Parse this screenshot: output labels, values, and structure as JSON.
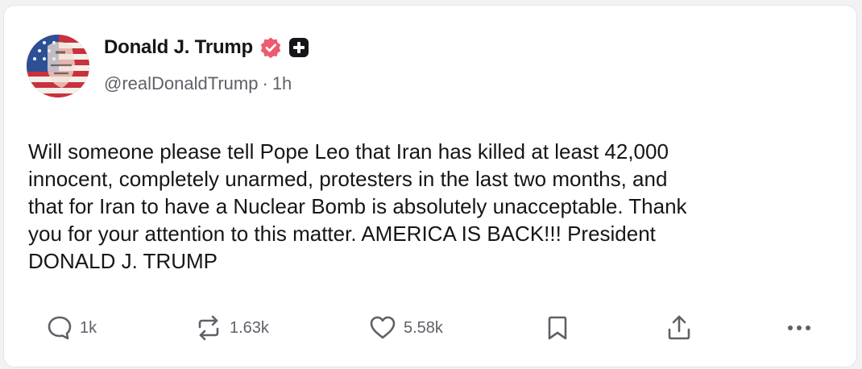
{
  "post": {
    "author_name": "Donald J. Trump",
    "handle": "@realDonaldTrump",
    "separator": "·",
    "time_ago": "1h",
    "text": "Will someone please tell Pope Leo that Iran has killed at least 42,000\ninnocent, completely unarmed, protesters in the last two months, and\nthat for Iran to have a Nuclear Bomb is absolutely unacceptable. Thank\nyou for your attention to this matter. AMERICA IS BACK!!! President\nDONALD J. TRUMP"
  },
  "actions": {
    "replies": "1k",
    "reposts": "1.63k",
    "likes": "5.58k"
  },
  "icons": {
    "verified": "verified-badge-icon",
    "plus": "plus-badge-icon",
    "reply": "reply-icon",
    "repost": "repost-icon",
    "like": "heart-icon",
    "bookmark": "bookmark-icon",
    "share": "share-icon",
    "more": "more-icon"
  },
  "colors": {
    "verified_badge": "#ee5a6e",
    "text": "#16161a",
    "muted": "#5f6168"
  }
}
